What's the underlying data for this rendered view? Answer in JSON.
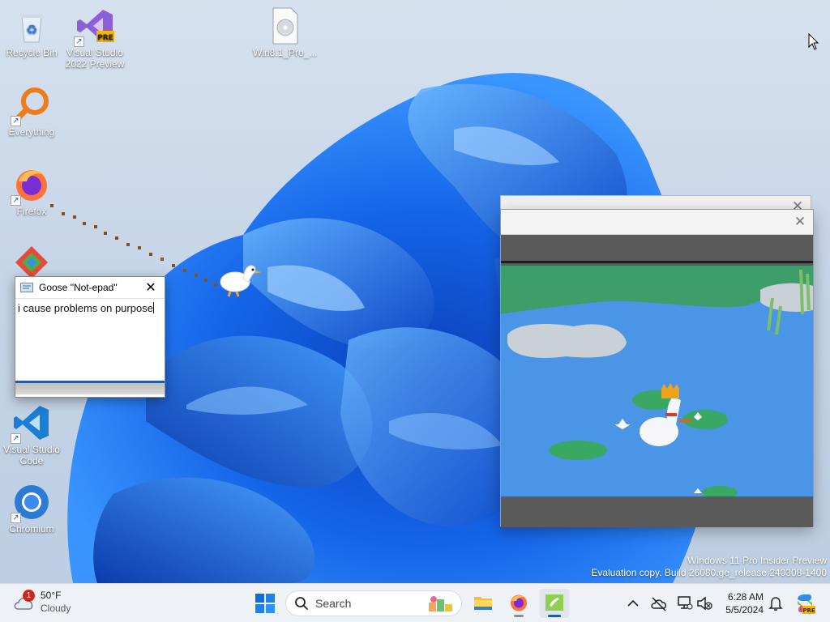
{
  "desktop": {
    "icons": [
      {
        "label": "Recycle Bin",
        "icon": "recycle-bin-icon"
      },
      {
        "label": "Visual Studio 2022 Preview",
        "icon": "visual-studio-icon",
        "badge": "PRE"
      },
      {
        "label": "Win8.1_Pro_...",
        "icon": "file-icon"
      },
      {
        "label": "Everything",
        "icon": "everything-search-icon"
      },
      {
        "label": "Firefox",
        "icon": "firefox-icon"
      },
      {
        "label": "Visual Studio Code",
        "icon": "vscode-icon"
      },
      {
        "label": "Chromium",
        "icon": "chromium-icon"
      }
    ]
  },
  "goose_note": {
    "title": "Goose \"Not-epad\"",
    "text": "i cause problems on purpose",
    "close_glyph": "✕"
  },
  "video_window": {
    "close_glyph": "✕"
  },
  "watermark": {
    "line1": "Windows 11 Pro Insider Preview",
    "line2": "Evaluation copy. Build 26080.ge_release.240308-1400"
  },
  "taskbar": {
    "weather": {
      "badge": "1",
      "temperature": "50°F",
      "condition": "Cloudy"
    },
    "search_placeholder": "Search",
    "apps": [
      "file-explorer-icon",
      "firefox-icon",
      "goose-app-icon"
    ],
    "clock": {
      "time": "6:28 AM",
      "date": "5/5/2024"
    }
  }
}
